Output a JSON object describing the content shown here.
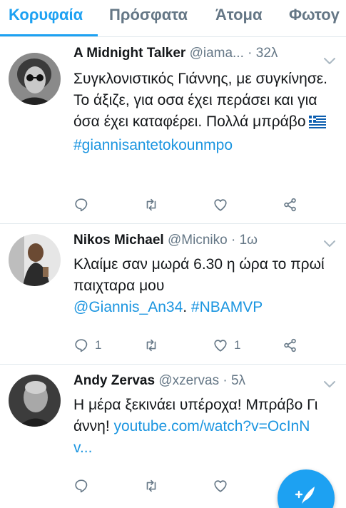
{
  "tabs": [
    {
      "label": "Κορυφαία",
      "active": true
    },
    {
      "label": "Πρόσφατα",
      "active": false
    },
    {
      "label": "Άτομα",
      "active": false
    },
    {
      "label": "Φωτογ",
      "active": false
    }
  ],
  "tweets": [
    {
      "name": "A Midnight Talker",
      "handle": "@iama...",
      "time": "32λ",
      "text": "Συγκλονιστικός Γιάννης, με συγκίνησε. Το άξιζε, για οσα έχει περάσει και για όσα έχει καταφέρει. Πολλά μπράβο",
      "hashtag": "#giannisantetokounmpo",
      "reply_count": "",
      "like_count": ""
    },
    {
      "name": "Nikos Michael",
      "handle": "@Micniko",
      "time": "1ω",
      "text_part1": "Κλαίμε σαν μωρά 6.30 η ώρα το πρωί παιχταρα μου",
      "mention": "@Giannis_An34",
      "text_part2": ". ",
      "hashtag": "#NBAMVP",
      "reply_count": "1",
      "like_count": "1"
    },
    {
      "name": "Andy Zervas",
      "handle": "@xzervas",
      "time": "5λ",
      "text": "Η μέρα ξεκινάει υπέροχα! Μπράβο Γιάννη!",
      "url_text": "youtube.com/watch?v=OcInNv...",
      "reply_count": "",
      "like_count": ""
    }
  ],
  "icons": {
    "reply": "reply-icon",
    "retweet": "retweet-icon",
    "like": "like-icon",
    "share": "share-icon",
    "more": "chevron-down-icon",
    "compose": "compose-tweet-icon",
    "flag": "greek-flag-icon"
  },
  "colors": {
    "accent": "#1da1f2",
    "link": "#1b95e0",
    "muted": "#657786",
    "text": "#14171a",
    "divider": "#e1e8ed"
  }
}
